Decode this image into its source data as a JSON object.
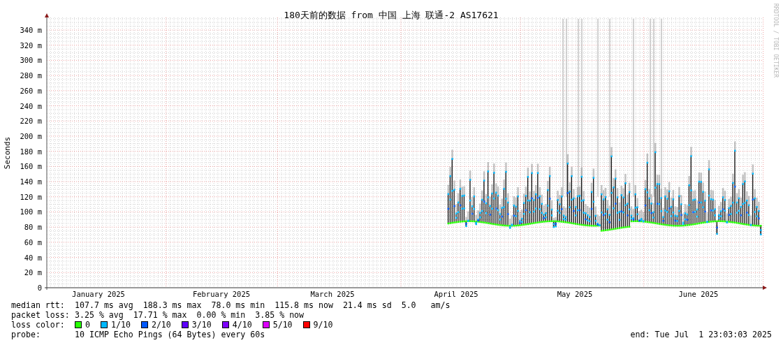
{
  "chart": {
    "title": "180天前的数据 from 中国 上海 联通-2 AS17621",
    "ylabel": "Seconds",
    "credit": "RRDTOOL / TOBI OETIKER",
    "yticks": [
      "340 m",
      "320 m",
      "300 m",
      "280 m",
      "260 m",
      "240 m",
      "220 m",
      "200 m",
      "180 m",
      "160 m",
      "140 m",
      "120 m",
      "100 m",
      "80 m",
      "60 m",
      "40 m",
      "20 m",
      "0"
    ],
    "months": [
      "January 2025",
      "February 2025",
      "March 2025",
      "April 2025",
      "May 2025",
      "June 2025"
    ]
  },
  "legend": {
    "median_rtt": {
      "label": "median rtt:",
      "values": [
        "107.7 ms avg",
        "188.3 ms max",
        "78.0 ms min",
        "115.8 ms now",
        "21.4 ms sd",
        "5.0   am/s"
      ]
    },
    "packet_loss": {
      "label": "packet loss:",
      "values": [
        "3.25 % avg",
        "17.71 % max",
        "0.00 % min",
        "3.85 % now"
      ]
    },
    "loss_color": {
      "label": "loss color:",
      "items": [
        {
          "label": "0",
          "color": "#26ff00"
        },
        {
          "label": "1/10",
          "color": "#00b8ff"
        },
        {
          "label": "2/10",
          "color": "#0059ff"
        },
        {
          "label": "3/10",
          "color": "#5e00ff"
        },
        {
          "label": "4/10",
          "color": "#7e00ff"
        },
        {
          "label": "5/10",
          "color": "#dd00ff"
        },
        {
          "label": "9/10",
          "color": "#ff0000"
        }
      ]
    },
    "probe": {
      "label": "probe:",
      "text": "10 ICMP Echo Pings (64 Bytes) every 60s"
    },
    "end": "end: Tue Jul  1 23:03:03 2025"
  }
}
